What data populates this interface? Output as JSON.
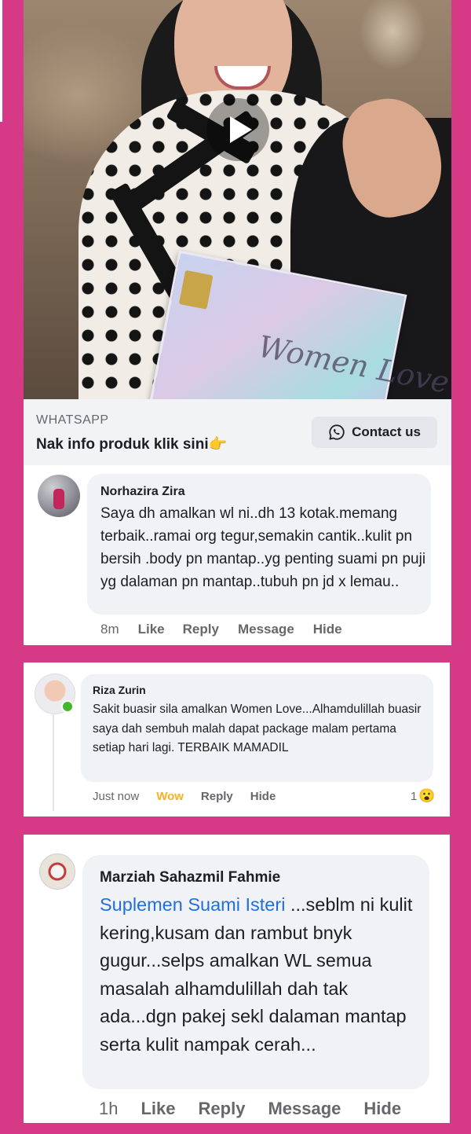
{
  "ad": {
    "source": "WHATSAPP",
    "headline": "Nak info produk klik sini",
    "headline_emoji": "👉",
    "button_label": "Contact us",
    "box_brand_text": "Women Love"
  },
  "comments": [
    {
      "author": "Norhazira Zira",
      "text": "Saya dh amalkan wl ni..dh 13 kotak.memang terbaik..ramai org tegur,semakin cantik..kulit pn bersih .body pn mantap..yg penting suami pn puji yg dalaman pn mantap..tubuh pn jd x lemau..",
      "time": "8m",
      "actions": [
        "Like",
        "Reply",
        "Message",
        "Hide"
      ]
    },
    {
      "author": "Riza Zurin",
      "text": "Sakit buasir sila amalkan Women Love...Alhamdulillah buasir saya dah sembuh malah dapat package malam pertama setiap hari lagi. TERBAIK MAMADIL",
      "time": "Just now",
      "reaction_active": "Wow",
      "actions": [
        "Reply",
        "Hide"
      ],
      "reaction_count": "1",
      "reaction_emoji": "😮"
    },
    {
      "author": "Marziah Sahazmil Fahmie",
      "link_text": "Suplemen Suami Isteri",
      "text": " ...seblm ni kulit kering,kusam dan rambut bnyk gugur...selps amalkan WL semua masalah alhamdulillah dah tak ada...dgn pakej sekl dalaman mantap serta kulit nampak cerah...",
      "time": "1h",
      "actions": [
        "Like",
        "Reply",
        "Message",
        "Hide"
      ]
    }
  ],
  "colors": {
    "background": "#d63a87",
    "bubble": "#f0f2f5",
    "link": "#216fdb",
    "wow": "#f7b125",
    "online": "#42b72a"
  }
}
